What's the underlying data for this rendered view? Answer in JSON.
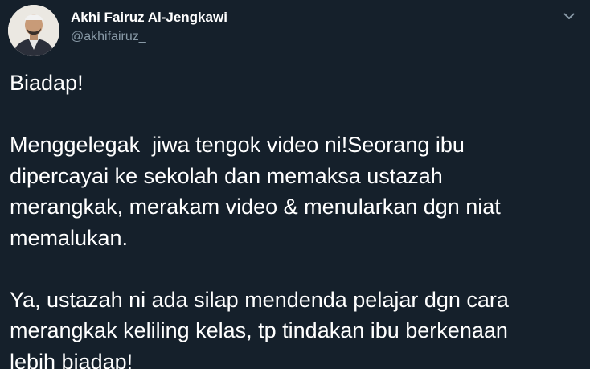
{
  "author": {
    "display_name": "Akhi Fairuz Al-Jengkawi",
    "handle": "@akhifairuz_",
    "avatar_icon": "profile-photo"
  },
  "menu": {
    "icon": "chevron-down-icon"
  },
  "tweet": {
    "paragraphs": [
      "Biadap!",
      "Menggelegak  jiwa tengok video ni!Seorang ibu\ndipercayai ke sekolah dan memaksa ustazah\nmerangkak, merakam video & menularkan dgn niat\nmemalukan.",
      "Ya, ustazah ni ada silap mendenda pelajar dgn cara\nmerangkak keliling kelas, tp tindakan ibu berkenaan\nlebih biadap!"
    ]
  },
  "colors": {
    "background": "#15202b",
    "text": "#ffffff",
    "muted": "#8899a6"
  }
}
